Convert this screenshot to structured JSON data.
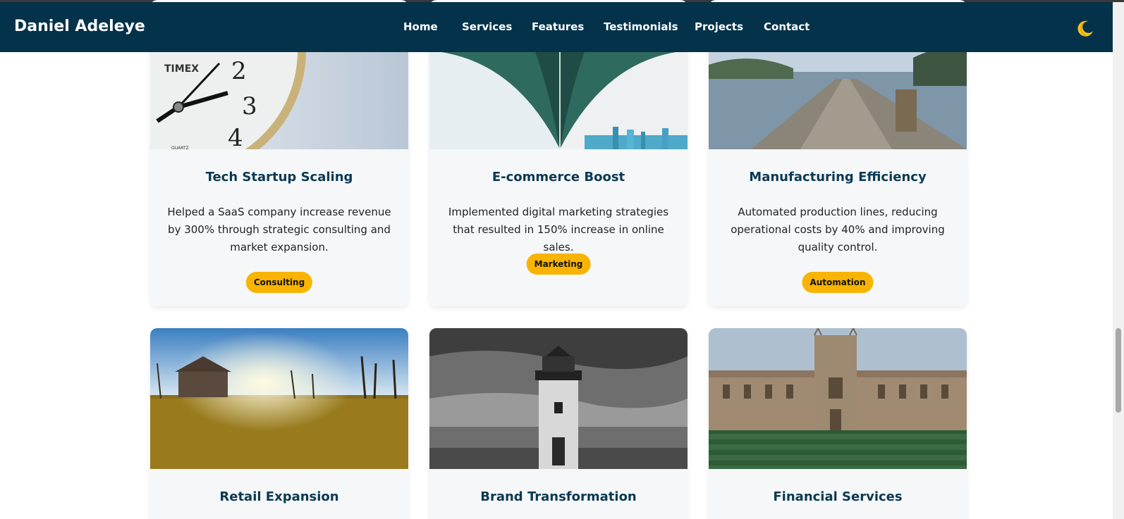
{
  "navbar": {
    "brand": "Daniel Adeleye",
    "links": [
      "Home",
      "Services",
      "Features",
      "Testimonials",
      "Projects",
      "Contact"
    ],
    "theme_icon": "moon-icon"
  },
  "projects": [
    {
      "title": "Tech Startup Scaling",
      "description": "Helped a SaaS company increase revenue by 300% through strategic consulting and market expansion.",
      "tag": "Consulting",
      "image": "clock-photo"
    },
    {
      "title": "E-commerce Boost",
      "description": "Implemented digital marketing strategies that resulted in 150% increase in online sales.",
      "tag": "Marketing",
      "image": "bridge-photo"
    },
    {
      "title": "Manufacturing Efficiency",
      "description": "Automated production lines, reducing operational costs by 40% and improving quality control.",
      "tag": "Automation",
      "image": "lake-dock-photo"
    },
    {
      "title": "Retail Expansion",
      "image": "sunset-field-photo"
    },
    {
      "title": "Brand Transformation",
      "image": "lighthouse-photo"
    },
    {
      "title": "Financial Services",
      "image": "college-building-photo"
    }
  ],
  "colors": {
    "navbar": "#04324a",
    "card_bg": "#f5f7f9",
    "title": "#0b3a52",
    "tag": "#f8b400"
  }
}
